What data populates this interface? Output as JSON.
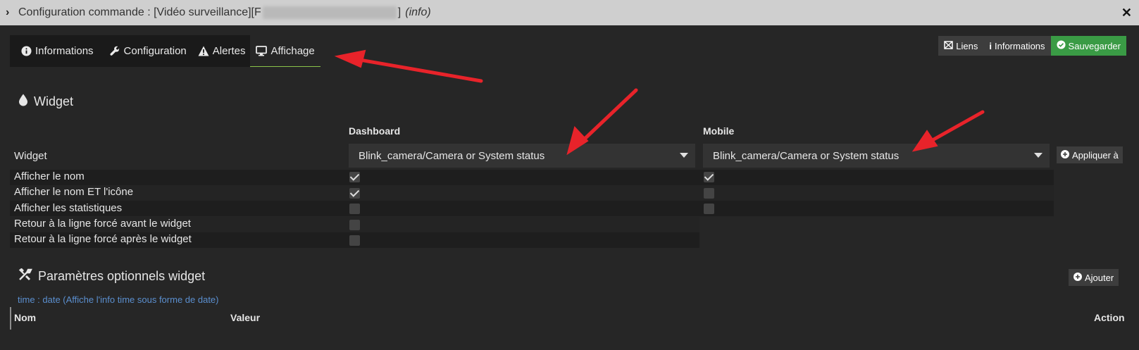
{
  "titlebar": {
    "prefix": "Configuration commande : [Vidéo surveillance][F",
    "suffix": "]",
    "info": "(info)"
  },
  "tabs": [
    {
      "label": "Informations",
      "icon": "info-circle-icon"
    },
    {
      "label": "Configuration",
      "icon": "wrench-icon"
    },
    {
      "label": "Alertes",
      "icon": "warning-icon"
    },
    {
      "label": "Affichage",
      "icon": "monitor-icon",
      "active": true
    }
  ],
  "top_buttons": {
    "links": "Liens",
    "informations": "Informations",
    "save": "Sauvegarder"
  },
  "widget_section": {
    "title": "Widget",
    "col_dashboard": "Dashboard",
    "col_mobile": "Mobile",
    "widget_label": "Widget",
    "dashboard_select": "Blink_camera/Camera or System status",
    "mobile_select": "Blink_camera/Camera or System status",
    "apply_button": "Appliquer à",
    "rows": [
      {
        "label": "Afficher le nom",
        "dashboard": true,
        "mobile": true
      },
      {
        "label": "Afficher le nom ET l'icône",
        "dashboard": true,
        "mobile": false
      },
      {
        "label": "Afficher les statistiques",
        "dashboard": false,
        "mobile": false
      },
      {
        "label": "Retour à la ligne forcé avant le widget",
        "dashboard": false
      },
      {
        "label": "Retour à la ligne forcé après le widget",
        "dashboard": false
      }
    ]
  },
  "params_section": {
    "title": "Paramètres optionnels widget",
    "add_button": "Ajouter",
    "hint": "time : date (Affiche l'info time sous forme de date)",
    "col_name": "Nom",
    "col_value": "Valeur",
    "col_action": "Action"
  },
  "colors": {
    "accent_green": "#3a9b45",
    "hint_blue": "#5b8fcf",
    "annotation_red": "#e8232a"
  }
}
